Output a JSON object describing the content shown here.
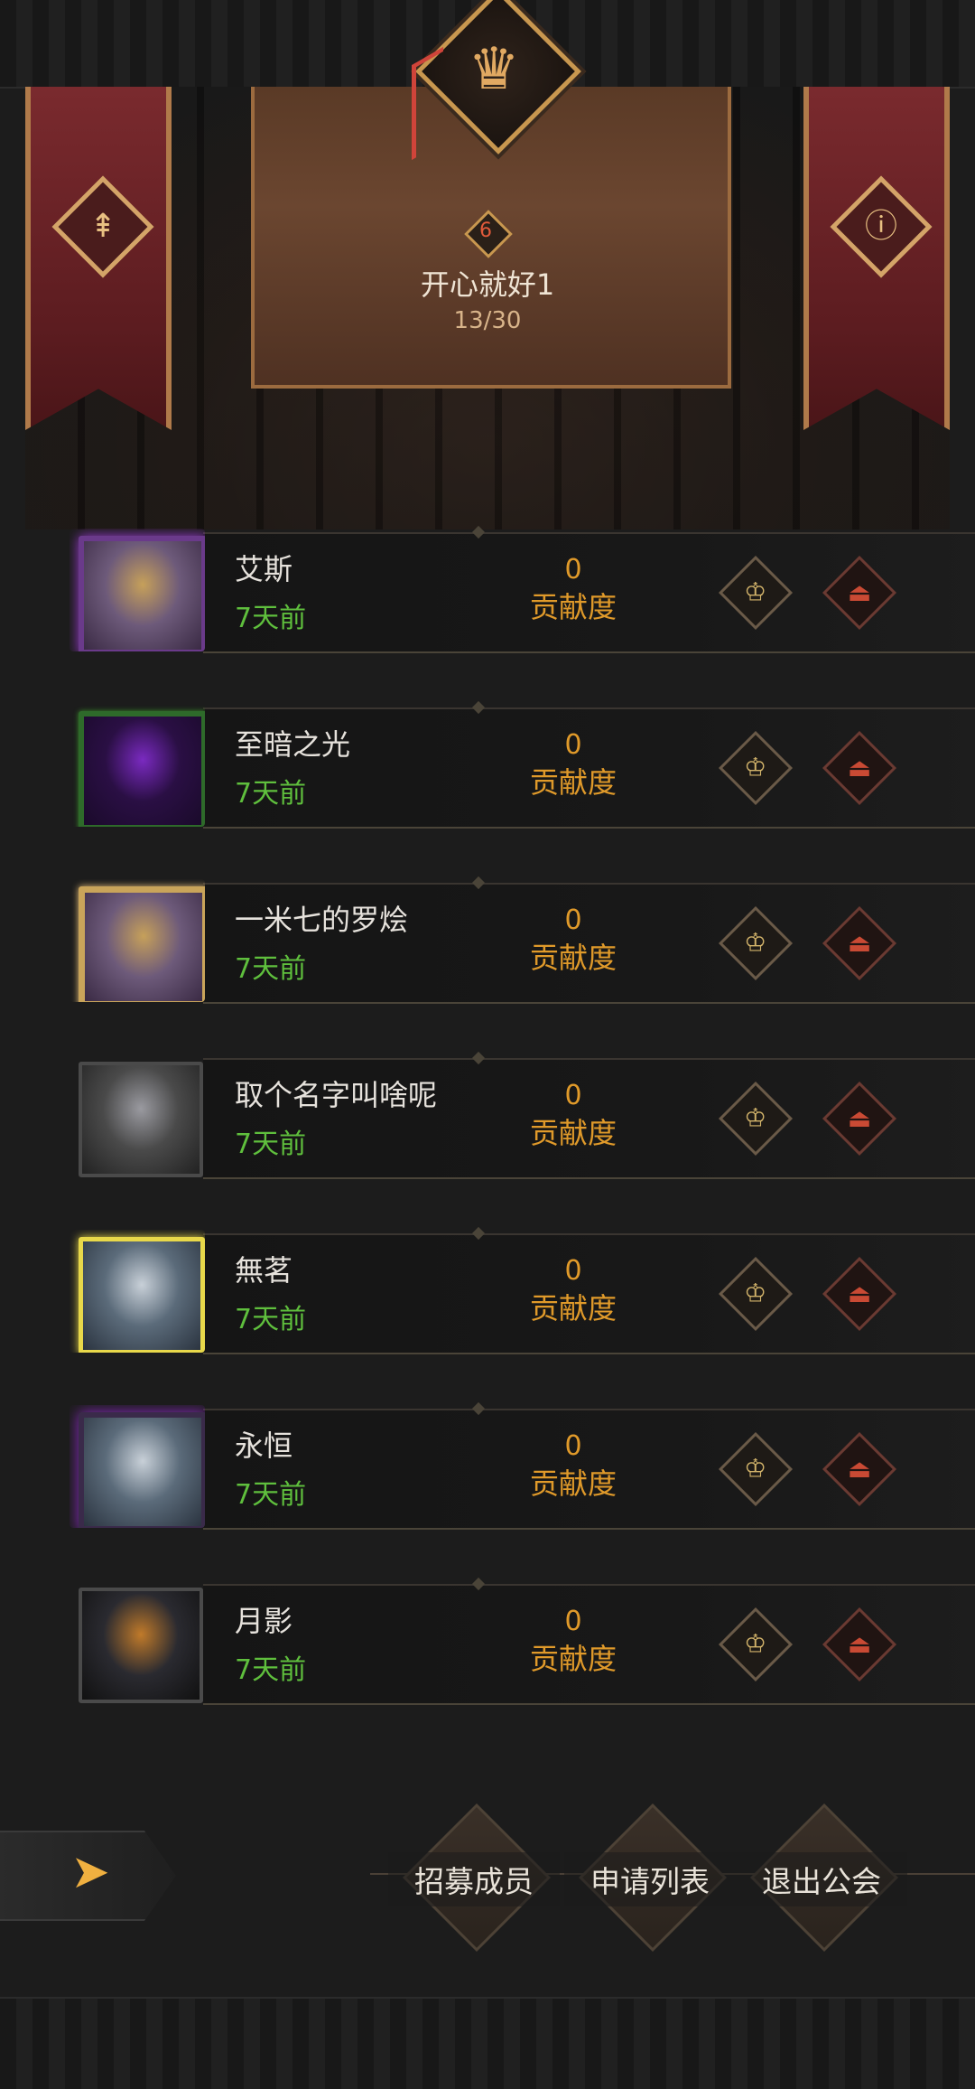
{
  "guild": {
    "name": "开心就好1",
    "level": "6",
    "member_count": "13/30",
    "crest_icon": "eagle-crest-icon"
  },
  "members": [
    {
      "name": "艾斯",
      "last_online": "7天前",
      "contribution": "0",
      "contribution_label": "贡献度",
      "frame": "purple",
      "art": [
        "#6d5a7a",
        "#c6a05a",
        "#3a2a44"
      ]
    },
    {
      "name": "至暗之光",
      "last_online": "7天前",
      "contribution": "0",
      "contribution_label": "贡献度",
      "frame": "vine",
      "art": [
        "#2a0f44",
        "#7a2ac0",
        "#1a0a2a"
      ]
    },
    {
      "name": "一米七的罗烩",
      "last_online": "7天前",
      "contribution": "0",
      "contribution_label": "贡献度",
      "frame": "gold",
      "art": [
        "#6d5a7a",
        "#c6a05a",
        "#3a2a44"
      ]
    },
    {
      "name": "取个名字叫啥呢",
      "last_online": "7天前",
      "contribution": "0",
      "contribution_label": "贡献度",
      "frame": "plain",
      "art": [
        "#4a4a4a",
        "#9a9aa0",
        "#222"
      ]
    },
    {
      "name": "無茗",
      "last_online": "7天前",
      "contribution": "0",
      "contribution_label": "贡献度",
      "frame": "yellow",
      "art": [
        "#5b6b7a",
        "#c8d0d8",
        "#2b3440"
      ]
    },
    {
      "name": "永恒",
      "last_online": "7天前",
      "contribution": "0",
      "contribution_label": "贡献度",
      "frame": "purple-glow",
      "art": [
        "#5b6b7a",
        "#c8d0d8",
        "#2b3440"
      ]
    },
    {
      "name": "月影",
      "last_online": "7天前",
      "contribution": "0",
      "contribution_label": "贡献度",
      "frame": "plain",
      "art": [
        "#2a2a30",
        "#c07a2a",
        "#111"
      ]
    }
  ],
  "bottom_bar": {
    "recruit": "招募成员",
    "applications": "申请列表",
    "quit": "退出公会"
  },
  "colors": {
    "accent_gold": "#e09a2a",
    "online_green": "#5fbf3d",
    "banner_red": "#7a2a2e"
  }
}
